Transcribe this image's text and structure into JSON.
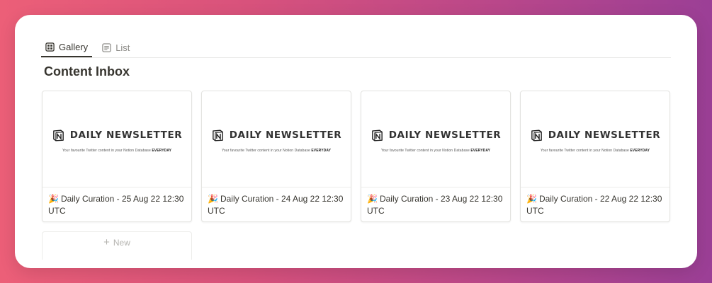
{
  "tabs": [
    {
      "label": "Gallery",
      "icon": "gallery-icon",
      "active": true
    },
    {
      "label": "List",
      "icon": "list-icon",
      "active": false
    }
  ],
  "page_title": "Content Inbox",
  "cover": {
    "brand": "DAILY NEWSLETTER",
    "tagline_prefix": "Your favourite Twitter content in your Notion Database",
    "tagline_bold": "EVERYDAY",
    "logo_icon": "notion-logo-icon"
  },
  "cards": [
    {
      "emoji": "🎉",
      "title": "Daily Curation - 25 Aug 22 12:30 UTC"
    },
    {
      "emoji": "🎉",
      "title": "Daily Curation - 24 Aug 22 12:30 UTC"
    },
    {
      "emoji": "🎉",
      "title": "Daily Curation - 23 Aug 22 12:30 UTC"
    },
    {
      "emoji": "🎉",
      "title": "Daily Curation - 22 Aug 22 12:30 UTC"
    }
  ],
  "new_label": "New",
  "new_icon": "plus-icon",
  "colors": {
    "text": "#37352f",
    "muted": "#8a8985",
    "border": "#e3e3e0"
  }
}
